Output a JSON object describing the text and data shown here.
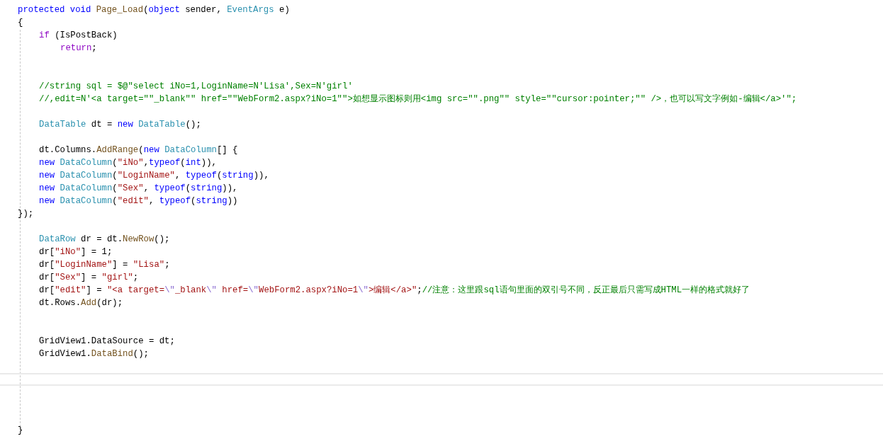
{
  "editor": {
    "lines": [
      {
        "kind": "code",
        "tokens": [
          {
            "kind": "kw",
            "text": "protected void "
          },
          {
            "kind": "method",
            "text": "Page_Load"
          },
          {
            "kind": "plain",
            "text": "("
          },
          {
            "kind": "kw",
            "text": "object"
          },
          {
            "kind": "plain",
            "text": " sender, "
          },
          {
            "kind": "type",
            "text": "EventArgs"
          },
          {
            "kind": "plain",
            "text": " e)"
          }
        ]
      },
      {
        "kind": "code",
        "tokens": [
          {
            "kind": "plain",
            "text": "{"
          }
        ]
      },
      {
        "kind": "block",
        "children": [
          {
            "kind": "code",
            "tokens": [
              {
                "kind": "ctrl",
                "text": "if"
              },
              {
                "kind": "plain",
                "text": " (IsPostBack)"
              }
            ]
          },
          {
            "kind": "block",
            "children": [
              {
                "kind": "code",
                "tokens": [
                  {
                    "kind": "ctrl",
                    "text": "return"
                  },
                  {
                    "kind": "plain",
                    "text": ";"
                  }
                ]
              }
            ]
          },
          {
            "kind": "blank"
          },
          {
            "kind": "blank"
          },
          {
            "kind": "code",
            "tokens": [
              {
                "kind": "comment",
                "text": "//string sql = $@\"select iNo=1,LoginName=N'Lisa',Sex=N'girl'"
              }
            ]
          },
          {
            "kind": "code",
            "tokens": [
              {
                "kind": "comment",
                "text": "//,edit=N'<a target=\"\"_blank\"\" href=\"\"WebForm2.aspx?iNo=1\"\">如想显示图标则用<img src=\"\".png\"\" style=\"\"cursor:pointer;\"\" />，也可以写文字例如-编辑</a>'\";"
              }
            ]
          },
          {
            "kind": "blank"
          },
          {
            "kind": "code",
            "tokens": [
              {
                "kind": "type",
                "text": "DataTable"
              },
              {
                "kind": "plain",
                "text": " dt = "
              },
              {
                "kind": "kw",
                "text": "new "
              },
              {
                "kind": "type",
                "text": "DataTable"
              },
              {
                "kind": "plain",
                "text": "();"
              }
            ]
          },
          {
            "kind": "blank"
          },
          {
            "kind": "code",
            "tokens": [
              {
                "kind": "plain",
                "text": "dt.Columns."
              },
              {
                "kind": "method",
                "text": "AddRange"
              },
              {
                "kind": "plain",
                "text": "("
              },
              {
                "kind": "kw",
                "text": "new "
              },
              {
                "kind": "type",
                "text": "DataColumn"
              },
              {
                "kind": "plain",
                "text": "[] {"
              }
            ]
          },
          {
            "kind": "code",
            "tokens": [
              {
                "kind": "kw",
                "text": "new "
              },
              {
                "kind": "type",
                "text": "DataColumn"
              },
              {
                "kind": "plain",
                "text": "("
              },
              {
                "kind": "str",
                "text": "\"iNo\""
              },
              {
                "kind": "plain",
                "text": ","
              },
              {
                "kind": "kw",
                "text": "typeof"
              },
              {
                "kind": "plain",
                "text": "("
              },
              {
                "kind": "kw",
                "text": "int"
              },
              {
                "kind": "plain",
                "text": ")),"
              }
            ]
          },
          {
            "kind": "code",
            "tokens": [
              {
                "kind": "kw",
                "text": "new "
              },
              {
                "kind": "type",
                "text": "DataColumn"
              },
              {
                "kind": "plain",
                "text": "("
              },
              {
                "kind": "str",
                "text": "\"LoginName\""
              },
              {
                "kind": "plain",
                "text": ", "
              },
              {
                "kind": "kw",
                "text": "typeof"
              },
              {
                "kind": "plain",
                "text": "("
              },
              {
                "kind": "kw",
                "text": "string"
              },
              {
                "kind": "plain",
                "text": ")),"
              }
            ]
          },
          {
            "kind": "code",
            "tokens": [
              {
                "kind": "kw",
                "text": "new "
              },
              {
                "kind": "type",
                "text": "DataColumn"
              },
              {
                "kind": "plain",
                "text": "("
              },
              {
                "kind": "str",
                "text": "\"Sex\""
              },
              {
                "kind": "plain",
                "text": ", "
              },
              {
                "kind": "kw",
                "text": "typeof"
              },
              {
                "kind": "plain",
                "text": "("
              },
              {
                "kind": "kw",
                "text": "string"
              },
              {
                "kind": "plain",
                "text": ")),"
              }
            ]
          },
          {
            "kind": "code",
            "tokens": [
              {
                "kind": "kw",
                "text": "new "
              },
              {
                "kind": "type",
                "text": "DataColumn"
              },
              {
                "kind": "plain",
                "text": "("
              },
              {
                "kind": "str",
                "text": "\"edit\""
              },
              {
                "kind": "plain",
                "text": ", "
              },
              {
                "kind": "kw",
                "text": "typeof"
              },
              {
                "kind": "plain",
                "text": "("
              },
              {
                "kind": "kw",
                "text": "string"
              },
              {
                "kind": "plain",
                "text": "))"
              }
            ]
          }
        ]
      },
      {
        "kind": "code",
        "tokens": [
          {
            "kind": "plain",
            "text": "});"
          }
        ]
      },
      {
        "kind": "block",
        "children": [
          {
            "kind": "blank"
          },
          {
            "kind": "code",
            "tokens": [
              {
                "kind": "type",
                "text": "DataRow"
              },
              {
                "kind": "plain",
                "text": " dr = dt."
              },
              {
                "kind": "method",
                "text": "NewRow"
              },
              {
                "kind": "plain",
                "text": "();"
              }
            ]
          },
          {
            "kind": "code",
            "tokens": [
              {
                "kind": "plain",
                "text": "dr["
              },
              {
                "kind": "str",
                "text": "\"iNo\""
              },
              {
                "kind": "plain",
                "text": "] = 1;"
              }
            ]
          },
          {
            "kind": "code",
            "tokens": [
              {
                "kind": "plain",
                "text": "dr["
              },
              {
                "kind": "str",
                "text": "\"LoginName\""
              },
              {
                "kind": "plain",
                "text": "] = "
              },
              {
                "kind": "str",
                "text": "\"Lisa\""
              },
              {
                "kind": "plain",
                "text": ";"
              }
            ]
          },
          {
            "kind": "code",
            "tokens": [
              {
                "kind": "plain",
                "text": "dr["
              },
              {
                "kind": "str",
                "text": "\"Sex\""
              },
              {
                "kind": "plain",
                "text": "] = "
              },
              {
                "kind": "str",
                "text": "\"girl\""
              },
              {
                "kind": "plain",
                "text": ";"
              }
            ]
          },
          {
            "kind": "code",
            "tokens": [
              {
                "kind": "plain",
                "text": "dr["
              },
              {
                "kind": "str",
                "text": "\"edit\""
              },
              {
                "kind": "plain",
                "text": "] = "
              },
              {
                "kind": "str",
                "text": "\"<a target="
              },
              {
                "kind": "esc",
                "text": "\\\""
              },
              {
                "kind": "str",
                "text": "_blank"
              },
              {
                "kind": "esc",
                "text": "\\\""
              },
              {
                "kind": "str",
                "text": " href="
              },
              {
                "kind": "esc",
                "text": "\\\""
              },
              {
                "kind": "str",
                "text": "WebForm2.aspx?iNo=1"
              },
              {
                "kind": "esc",
                "text": "\\\""
              },
              {
                "kind": "str",
                "text": ">编辑</a>\""
              },
              {
                "kind": "plain",
                "text": ";"
              },
              {
                "kind": "comment",
                "text": "//注意：这里跟sql语句里面的双引号不同，反正最后只需写成HTML一样的格式就好了"
              }
            ]
          },
          {
            "kind": "code",
            "tokens": [
              {
                "kind": "plain",
                "text": "dt.Rows."
              },
              {
                "kind": "method",
                "text": "Add"
              },
              {
                "kind": "plain",
                "text": "(dr);"
              }
            ]
          },
          {
            "kind": "blank"
          },
          {
            "kind": "blank"
          },
          {
            "kind": "code",
            "tokens": [
              {
                "kind": "plain",
                "text": "GridView1.DataSource = dt;"
              }
            ]
          },
          {
            "kind": "code",
            "tokens": [
              {
                "kind": "plain",
                "text": "GridView1."
              },
              {
                "kind": "method",
                "text": "DataBind"
              },
              {
                "kind": "plain",
                "text": "();"
              }
            ]
          },
          {
            "kind": "blank"
          },
          {
            "kind": "cursor-line"
          },
          {
            "kind": "blank"
          },
          {
            "kind": "blank"
          },
          {
            "kind": "blank"
          }
        ]
      },
      {
        "kind": "code",
        "tokens": [
          {
            "kind": "plain",
            "text": "}"
          }
        ]
      }
    ]
  }
}
